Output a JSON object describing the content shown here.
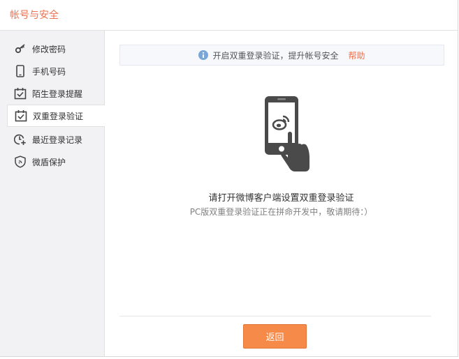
{
  "window": {
    "title": "帐号与安全"
  },
  "sidebar": {
    "items": [
      {
        "label": "修改密码",
        "icon": "key-icon",
        "active": false
      },
      {
        "label": "手机号码",
        "icon": "phone-icon",
        "active": false
      },
      {
        "label": "陌生登录提醒",
        "icon": "calendar-check-icon",
        "active": false
      },
      {
        "label": "双重登录验证",
        "icon": "calendar-check-icon",
        "active": true
      },
      {
        "label": "最近登录记录",
        "icon": "clock-plus-icon",
        "active": false
      },
      {
        "label": "微盾保护",
        "icon": "shield-icon",
        "active": false
      }
    ]
  },
  "notice": {
    "text": "开启双重登录验证，提升帐号安全",
    "help_label": "帮助",
    "icon": "info-icon"
  },
  "main": {
    "illustration_icon": "phone-tap-weibo-icon",
    "headline": "请打开微博客户端设置双重登录验证",
    "subtext": "PC版双重登录验证正在拼命开发中，敬请期待：）"
  },
  "footer": {
    "back_label": "返回"
  },
  "colors": {
    "accent": "#eb7350",
    "button": "#f58a49",
    "sidebar_bg": "#f2f2f5",
    "notice_bg": "#f6f8fc",
    "info_icon": "#7aa7d8",
    "icon_gray": "#555555"
  }
}
